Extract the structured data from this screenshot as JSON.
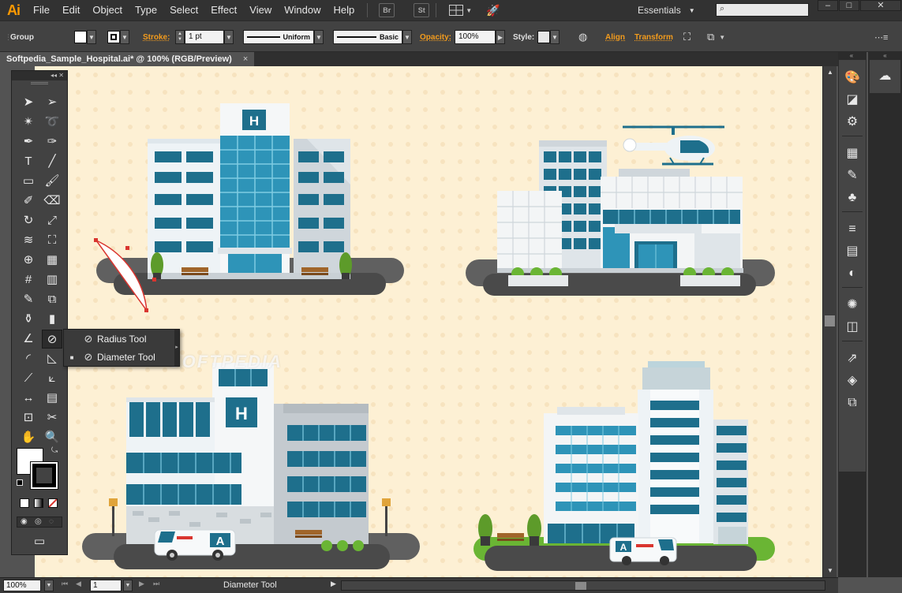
{
  "app": {
    "logo": "Ai",
    "menu": [
      "File",
      "Edit",
      "Object",
      "Type",
      "Select",
      "Effect",
      "View",
      "Window",
      "Help"
    ],
    "bridge_label": "Br",
    "stock_label": "St",
    "workspace": "Essentials",
    "search_placeholder": ""
  },
  "control_bar": {
    "selection_label": "Group",
    "stroke_label": "Stroke:",
    "stroke_weight": "1 pt",
    "profile_label": "Uniform",
    "brush_label": "Basic",
    "opacity_label": "Opacity:",
    "opacity_value": "100%",
    "style_label": "Style:",
    "align_label": "Align",
    "transform_label": "Transform"
  },
  "document": {
    "tab_title": "Softpedia_Sample_Hospital.ai* @ 100% (RGB/Preview)",
    "close_glyph": "×",
    "watermark": "SOFTPEDIA"
  },
  "tool_flyout": {
    "items": [
      {
        "label": "Radius Tool",
        "selected": false,
        "icon": "radius-icon"
      },
      {
        "label": "Diameter Tool",
        "selected": true,
        "icon": "diameter-icon"
      }
    ]
  },
  "canvas_art": {
    "signs": [
      "H",
      "H"
    ],
    "ambulance_letter": "A"
  },
  "status_bar": {
    "zoom": "100%",
    "artboard": "1",
    "current_tool": "Diameter Tool"
  },
  "colors": {
    "accent_orange": "#f29b1d",
    "canvas_bg": "#fdf0d4",
    "teal": "#2e94b8",
    "dark_teal": "#1e6f8c"
  }
}
